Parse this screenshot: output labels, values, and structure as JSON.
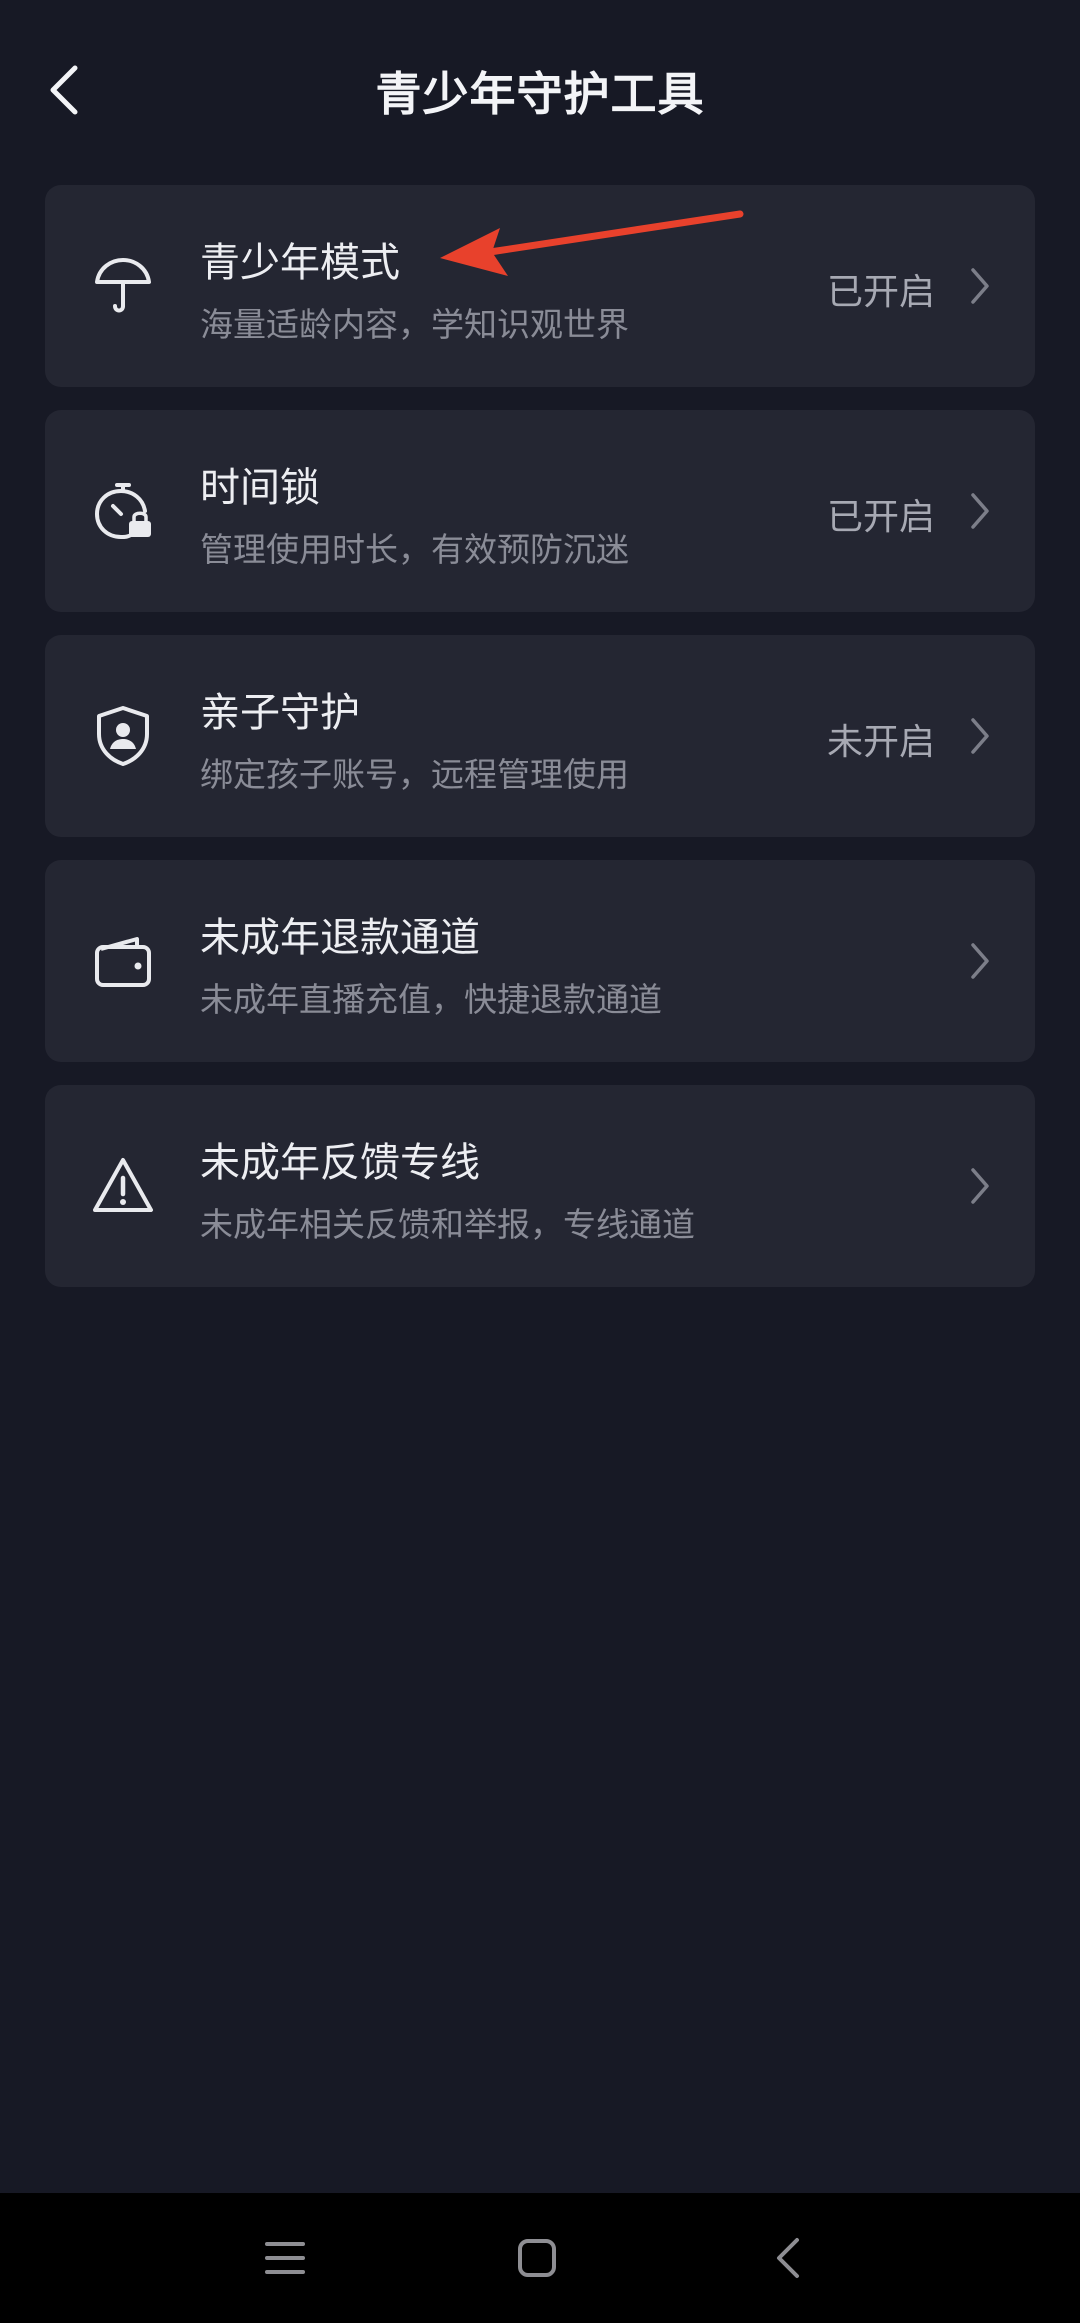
{
  "header": {
    "title": "青少年守护工具",
    "back_icon": "chevron-left-icon"
  },
  "menu": {
    "items": [
      {
        "title": "青少年模式",
        "desc": "海量适龄内容，学知识观世界",
        "status": "已开启",
        "icon": "umbrella-icon"
      },
      {
        "title": "时间锁",
        "desc": "管理使用时长，有效预防沉迷",
        "status": "已开启",
        "icon": "timer-lock-icon"
      },
      {
        "title": "亲子守护",
        "desc": "绑定孩子账号，远程管理使用",
        "status": "未开启",
        "icon": "shield-person-icon"
      },
      {
        "title": "未成年退款通道",
        "desc": "未成年直播充值，快捷退款通道",
        "status": "",
        "icon": "wallet-icon"
      },
      {
        "title": "未成年反馈专线",
        "desc": "未成年相关反馈和举报，专线通道",
        "status": "",
        "icon": "warning-triangle-icon"
      }
    ]
  },
  "annotation": {
    "color": "#E8412C"
  },
  "navbar": {
    "menu_icon": "menu-lines-icon",
    "home_icon": "home-square-icon",
    "back_icon": "back-triangle-icon"
  },
  "colors": {
    "background": "#171925",
    "card": "#242632",
    "title_text": "#EDEEF2",
    "desc_text": "#8A8C97"
  }
}
